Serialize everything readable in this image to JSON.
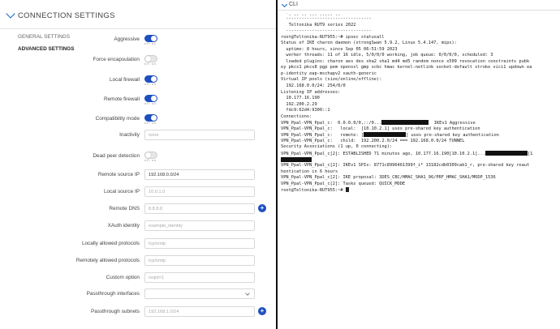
{
  "left": {
    "section_title": "CONNECTION SETTINGS",
    "tabs": [
      {
        "label": "GENERAL SETTINGS"
      },
      {
        "label": "ADVANCED SETTINGS"
      }
    ],
    "toggle_off": "off",
    "toggle_on": "on",
    "fields": {
      "aggressive": {
        "label": "Aggressive"
      },
      "force_encapsulation": {
        "label": "Force encapsulation"
      },
      "local_firewall": {
        "label": "Local firewall"
      },
      "remote_firewall": {
        "label": "Remote firewall"
      },
      "compatibility_mode": {
        "label": "Compatibility mode"
      },
      "inactivity": {
        "label": "Inactivity",
        "placeholder": "none"
      },
      "dead_peer_detection": {
        "label": "Dead peer detection"
      },
      "remote_source_ip": {
        "label": "Remote source IP",
        "value": "192.168.0.0/24"
      },
      "local_source_ip": {
        "label": "Local source IP",
        "placeholder": "10.0.1.0"
      },
      "remote_dns": {
        "label": "Remote DNS",
        "placeholder": "8.8.8.8"
      },
      "xauth_identity": {
        "label": "XAuth identity",
        "placeholder": "example_identity"
      },
      "locally_allowed_protocols": {
        "label": "Locally allowed protocols",
        "placeholder": "tcp/smtp"
      },
      "remotely_allowed_protocols": {
        "label": "Remotely allowed protocols",
        "placeholder": "tcp/smtp"
      },
      "custom_option": {
        "label": "Custom option",
        "placeholder": "reqid=1"
      },
      "passthrough_interfaces": {
        "label": "Passthrough interfaces"
      },
      "passthrough_subnets": {
        "label": "Passthrough subnets",
        "placeholder": "192.168.1.0/24"
      }
    },
    "plus_glyph": "+"
  },
  "right": {
    "title": "CLI",
    "lines": {
      "l0": "  `- -- -- --- ----- --",
      "l1": "  ---------------------------------",
      "l2": "   Teltonika RUT9 series 2022",
      "l3": "  ---------------------------------",
      "l4": "root@Teltonika-RUT955:~# ipsec statusall",
      "l5": "Status of IKE charon daemon (strongSwan 5.9.2, Linux 5.4.147, mips):",
      "l6": "  uptime: 8 hours, since Sep 05 06:51:59 2023",
      "l7": "  worker threads: 11 of 16 idle, 5/0/0/0 working, job queue: 0/0/0/0, scheduled: 3",
      "l8": "  loaded plugins: charon aes des sha2 sha1 md4 md5 random nonce x509 revocation constraints pubk",
      "l9": "ey pkcs1 pkcs8 pgp pem openssl gmp xcbc hmac kernel-netlink socket-default stroke vici1 updown ea",
      "l10": "p-identity eap-mschapv2 xauth-generic",
      "l11": "Virtual IP pools (size/online/offline):",
      "l12": "  192.168.0.0/24: 254/0/0",
      "l13": "Listening IP addresses:",
      "l14": "  10.177.16.190",
      "l15": "  192.200.2.29",
      "l16": "  fdc9:62d4:9300::1",
      "l17": "Connections:",
      "l18a": "VPN_Ppal-VPN_Ppal_c:  0.0.0.0/0,::/0...",
      "l18b": "  IKEv1 Aggressive",
      "l19": "VPN_Ppal-VPN_Ppal_c:   local:  [10.10.2.1] uses pre-shared key authentication",
      "l20a": "VPN_Ppal-VPN_Ppal_c:   remote: [",
      "l20b": "] uses pre-shared key authentication",
      "l21": "VPN_Ppal-VPN_Ppal_c:   child:  192.200.2.0/24 === 192.168.0.0/24 TUNNEL",
      "l22": "Security Associations (1 up, 0 connecting):",
      "l23a": "VPN_Ppal-VPN_Ppal_c[2]: ESTABLISHED 71 minutes ago, 10.177.16.190[10.10.2.1]...",
      "l23b": "[1",
      "l24": "",
      "l25": "VPN_Ppal-VPN_Ppal_c[2]: IKEv1 SPIs: 8771c8996461399f_i* 13182cdb0309cab1_r, pre-shared key reaut",
      "l26": "hentication in 6 hours",
      "l27": "VPN_Ppal-VPN_Ppal_c[2]: IKE proposal: 3DES_CBC/HMAC_SHA1_96/PRF_HMAC_SHA1/MODP_1536",
      "l28": "VPN_Ppal-VPN_Ppal_c[2]: Tasks queued: QUICK_MODE",
      "l29": "root@Teltonika-RUT955:~# "
    }
  }
}
